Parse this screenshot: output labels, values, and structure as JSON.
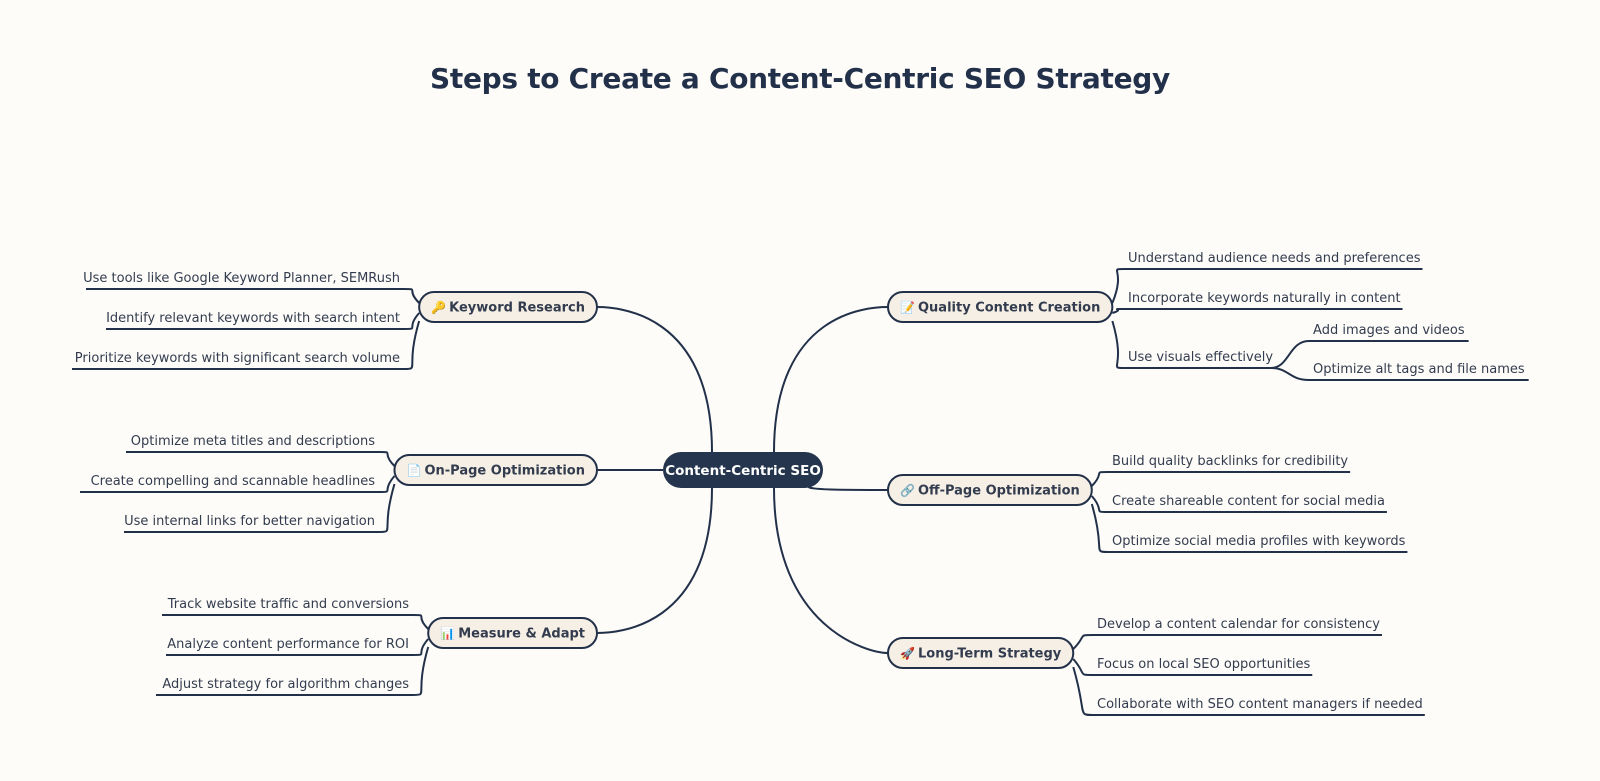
{
  "title": "Steps to Create a Content-Centric SEO Strategy",
  "colors": {
    "line": "#223149",
    "root_fill": "#25354d",
    "node_fill": "#f6efe5",
    "text": "#333c4e",
    "background": "#fdfcf9"
  },
  "root": {
    "label": "Content-Centric SEO"
  },
  "branches": [
    {
      "id": "keyword-research",
      "side": "left",
      "label": "Keyword Research",
      "icon": "key-icon",
      "icon_glyph": "🔑",
      "icon_color": "#f5a623",
      "children": [
        {
          "label": "Use tools like Google Keyword Planner, SEMRush"
        },
        {
          "label": "Identify relevant keywords with search intent"
        },
        {
          "label": "Prioritize keywords with significant search volume"
        }
      ]
    },
    {
      "id": "on-page-optimization",
      "side": "left",
      "label": "On-Page Optimization",
      "icon": "document-icon",
      "icon_glyph": "📄",
      "icon_color": "#b9b9b9",
      "children": [
        {
          "label": "Optimize meta titles and descriptions"
        },
        {
          "label": "Create compelling and scannable headlines"
        },
        {
          "label": "Use internal links for better navigation"
        }
      ]
    },
    {
      "id": "measure-adapt",
      "side": "left",
      "label": "Measure & Adapt",
      "icon": "bar-chart-icon",
      "icon_glyph": "📊",
      "icon_color": "#1fb5a8",
      "children": [
        {
          "label": "Track website traffic and conversions"
        },
        {
          "label": "Analyze content performance for ROI"
        },
        {
          "label": "Adjust strategy for algorithm changes"
        }
      ]
    },
    {
      "id": "quality-content-creation",
      "side": "right",
      "label": "Quality Content Creation",
      "icon": "memo-icon",
      "icon_glyph": "📝",
      "icon_color": "#e8553d",
      "children": [
        {
          "label": "Understand audience needs and preferences"
        },
        {
          "label": "Incorporate keywords naturally in content"
        },
        {
          "label": "Use visuals effectively",
          "children": [
            {
              "label": "Add images and videos"
            },
            {
              "label": "Optimize alt tags and file names"
            }
          ]
        }
      ]
    },
    {
      "id": "off-page-optimization",
      "side": "right",
      "label": "Off-Page Optimization",
      "icon": "link-icon",
      "icon_glyph": "🔗",
      "icon_color": "#9aa3ad",
      "children": [
        {
          "label": "Build quality backlinks for credibility"
        },
        {
          "label": "Create shareable content for social media"
        },
        {
          "label": "Optimize social media profiles with keywords"
        }
      ]
    },
    {
      "id": "long-term-strategy",
      "side": "right",
      "label": "Long-Term Strategy",
      "icon": "rocket-icon",
      "icon_glyph": "🚀",
      "icon_color": "#e8453d",
      "children": [
        {
          "label": "Develop a content calendar for consistency"
        },
        {
          "label": "Focus on local SEO opportunities"
        },
        {
          "label": "Collaborate with SEO content managers if needed"
        }
      ]
    }
  ]
}
